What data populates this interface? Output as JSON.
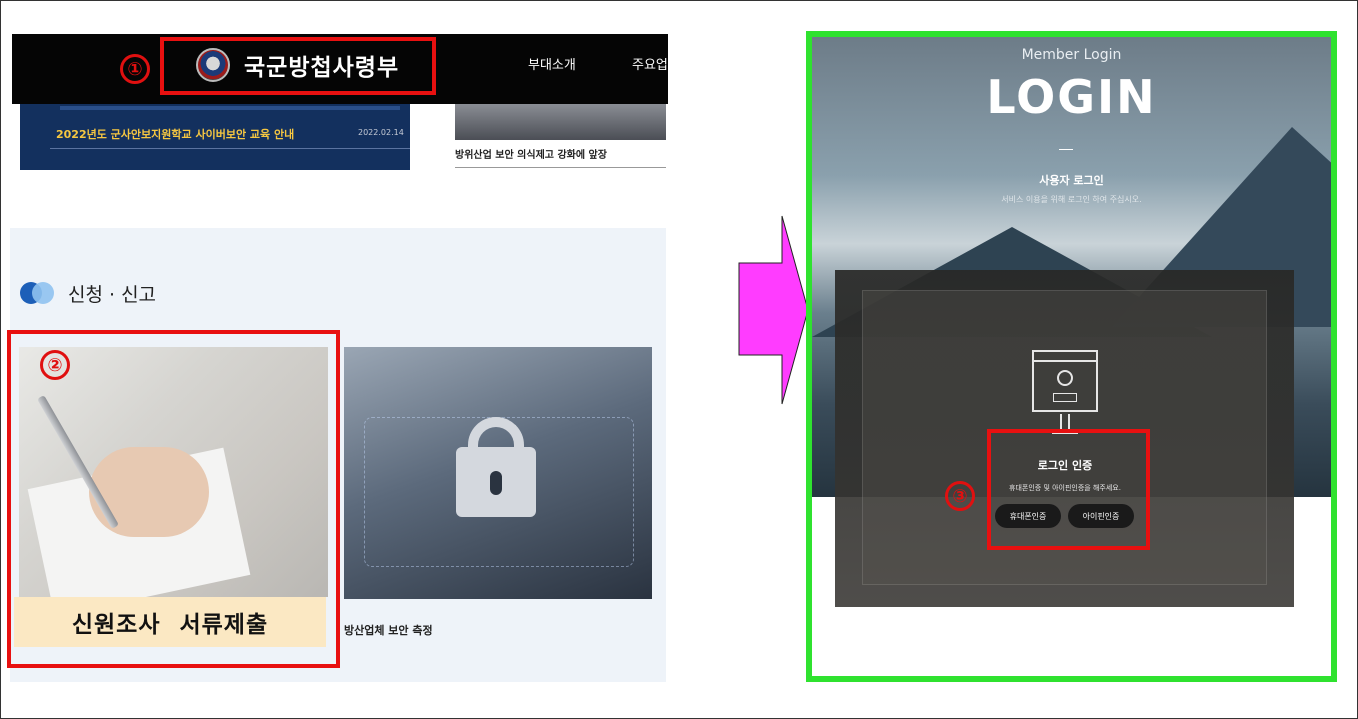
{
  "left_site": {
    "header": {
      "brand": "국군방첩사령부",
      "nav_items": [
        "부대소개",
        "주요업"
      ]
    },
    "notice": {
      "title": "2022년도 군사안보지원학교 사이버보안 교육 안내",
      "date": "2022.02.14"
    },
    "photo_caption": "방위산업 보안 의식제고 강화에 앞장",
    "application": {
      "section_title": "신청 · 신고",
      "cards": [
        {
          "label": "신원조사 서류제출"
        },
        {
          "label": "방산업체 보안 측정"
        }
      ]
    }
  },
  "login_site": {
    "subtitle": "Member Login",
    "title": "LOGIN",
    "user_login": "사용자 로그인",
    "user_login_sub": "서비스 이용을 위해 로그인 하여 주십시오.",
    "auth_title": "로그인 인증",
    "auth_sub": "휴대폰인증 및 아이핀인증을 해주세요.",
    "phone_button": "휴대폰인증",
    "ipin_button": "아이핀인증"
  },
  "annotations": {
    "step1": "①",
    "step2": "②",
    "step3": "③",
    "highlight_color": "#e81010",
    "frame_color": "#2fe22f",
    "arrow_color": "#ff3cff"
  }
}
